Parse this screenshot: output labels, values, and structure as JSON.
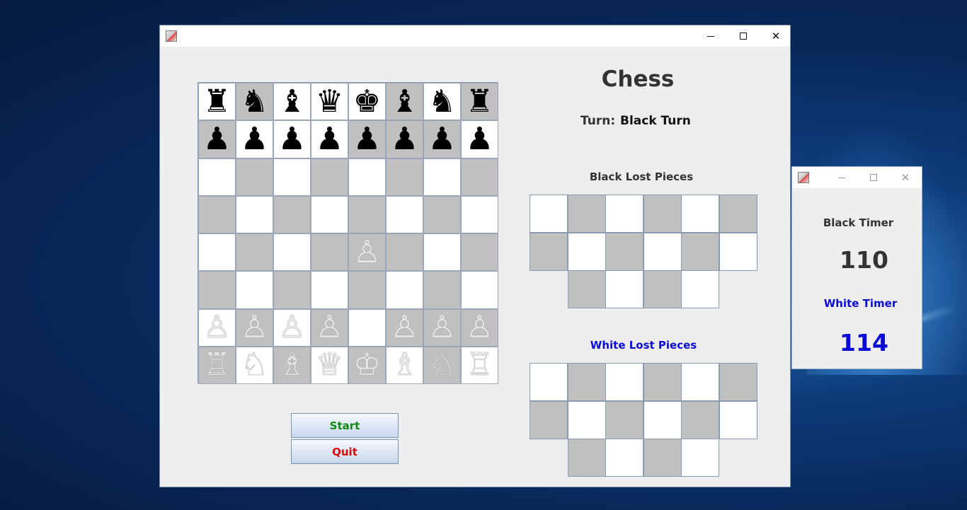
{
  "desktop": {
    "background": "windows-10-blue"
  },
  "main_window": {
    "title": "",
    "app_icon": "java-cup-icon",
    "controls": {
      "minimize": "minimize-icon",
      "maximize": "maximize-icon",
      "close": "close-icon"
    }
  },
  "game": {
    "heading": "Chess",
    "turn_label": "Turn:",
    "turn_value": "Black Turn",
    "board": [
      [
        "♜",
        "♞",
        "♝",
        "♛",
        "♚",
        "♝",
        "♞",
        "♜"
      ],
      [
        "♟",
        "♟",
        "♟",
        "♟",
        "♟",
        "♟",
        "♟",
        "♟"
      ],
      [
        "",
        "",
        "",
        "",
        "",
        "",
        "",
        ""
      ],
      [
        "",
        "",
        "",
        "",
        "",
        "",
        "",
        ""
      ],
      [
        "",
        "",
        "",
        "",
        "♙",
        "",
        "",
        ""
      ],
      [
        "",
        "",
        "",
        "",
        "",
        "",
        "",
        ""
      ],
      [
        "♙",
        "♙",
        "♙",
        "♙",
        "",
        "♙",
        "♙",
        "♙"
      ],
      [
        "♖",
        "♘",
        "♗",
        "♕",
        "♔",
        "♗",
        "♘",
        "♖"
      ]
    ],
    "board_colors": [
      [
        "L",
        "D",
        "L",
        "L",
        "L",
        "D",
        "L",
        "D"
      ],
      [
        "D",
        "L",
        "L",
        "L",
        "D",
        "D",
        "D",
        "L"
      ],
      [
        "L",
        "D",
        "L",
        "D",
        "L",
        "D",
        "L",
        "D"
      ],
      [
        "D",
        "L",
        "D",
        "L",
        "D",
        "L",
        "D",
        "L"
      ],
      [
        "L",
        "D",
        "L",
        "D",
        "D",
        "D",
        "L",
        "D"
      ],
      [
        "D",
        "L",
        "D",
        "L",
        "D",
        "L",
        "D",
        "L"
      ],
      [
        "L",
        "D",
        "L",
        "D",
        "L",
        "D",
        "D",
        "D"
      ],
      [
        "D",
        "L",
        "D",
        "L",
        "D",
        "L",
        "D",
        "L"
      ]
    ],
    "black_lost_title": "Black Lost Pieces",
    "white_lost_title": "White Lost Pieces",
    "start_button": "Start",
    "quit_button": "Quit"
  },
  "timer_window": {
    "app_icon": "java-cup-icon",
    "black_timer_label": "Black Timer",
    "black_timer_value": "110",
    "white_timer_label": "White Timer",
    "white_timer_value": "114"
  },
  "colors": {
    "light_square": "#ffffff",
    "dark_square": "#c0c0c0",
    "start_text": "#128a12",
    "quit_text": "#e00000",
    "white_accent": "#0a0ad8"
  }
}
